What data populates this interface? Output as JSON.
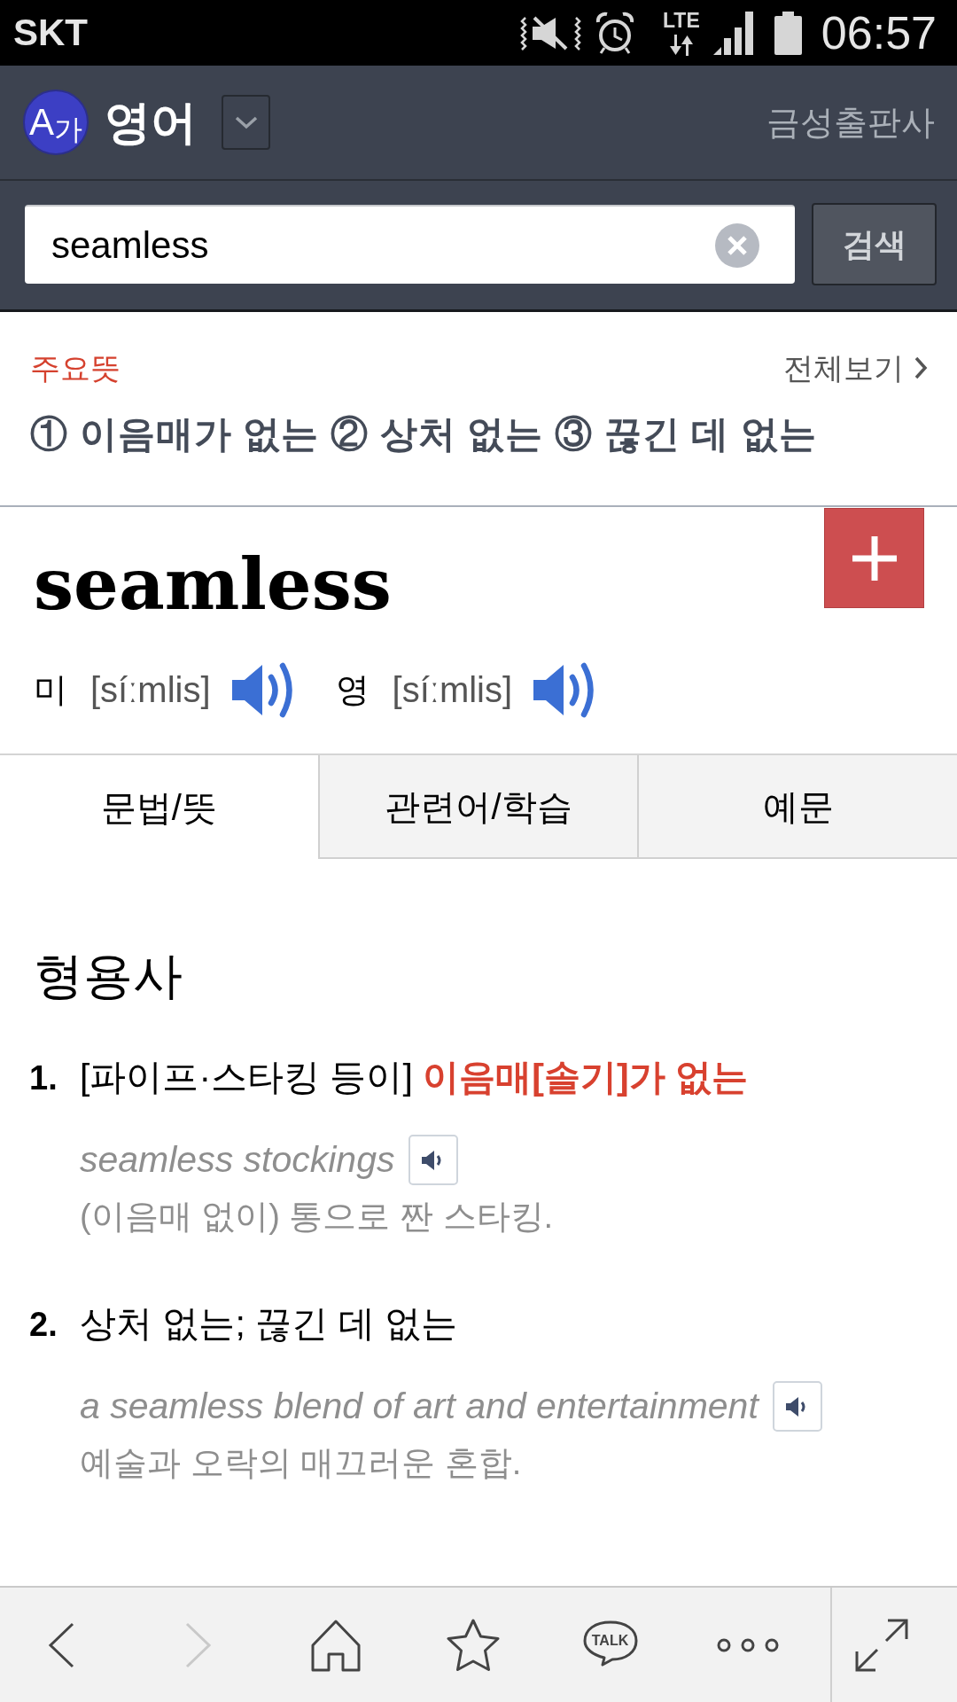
{
  "status_bar": {
    "carrier": "SKT",
    "network": "LTE",
    "time": "06:57"
  },
  "header": {
    "logo": "A$_{가}$",
    "title": "영어",
    "publisher": "금성출판사"
  },
  "search": {
    "value": "seamless",
    "button": "검색"
  },
  "summary": {
    "label": "주요뜻",
    "more_link": "전체보기",
    "meanings": "① 이음매가 없는 ② 상처 없는 ③ 끊긴 데 없는"
  },
  "entry": {
    "headword": "seamless",
    "pronunciations": [
      {
        "region": "미",
        "ipa": "[síːmlis]"
      },
      {
        "region": "영",
        "ipa": "[síːmlis]"
      }
    ]
  },
  "tabs": [
    {
      "label": "문법/뜻",
      "selected": true
    },
    {
      "label": "관련어/학습",
      "selected": false
    },
    {
      "label": "예문",
      "selected": false
    }
  ],
  "part_of_speech": "형용사",
  "senses": [
    {
      "number": "1.",
      "context": "[파이프·스타킹 등이]",
      "meaning": "이음매[솔기]가 없는",
      "emphasized": true,
      "example": {
        "sentence": "seamless stockings",
        "translation": "(이음매 없이) 통으로 짠 스타킹."
      }
    },
    {
      "number": "2.",
      "meaning": "상처 없는; 끊긴 데 없는",
      "emphasized": false,
      "example": {
        "sentence": "a seamless blend of art and entertainment",
        "translation": "예술과 오락의 매끄러운 혼합."
      }
    }
  ],
  "bottom_bar": [
    {
      "kind": "back",
      "disabled": false
    },
    {
      "kind": "forward",
      "disabled": true
    },
    {
      "kind": "home",
      "disabled": false
    },
    {
      "kind": "bookmark",
      "disabled": false
    },
    {
      "kind": "talk",
      "label": "TALK",
      "disabled": false
    },
    {
      "kind": "more",
      "disabled": false
    },
    {
      "kind": "expand",
      "disabled": false
    }
  ]
}
